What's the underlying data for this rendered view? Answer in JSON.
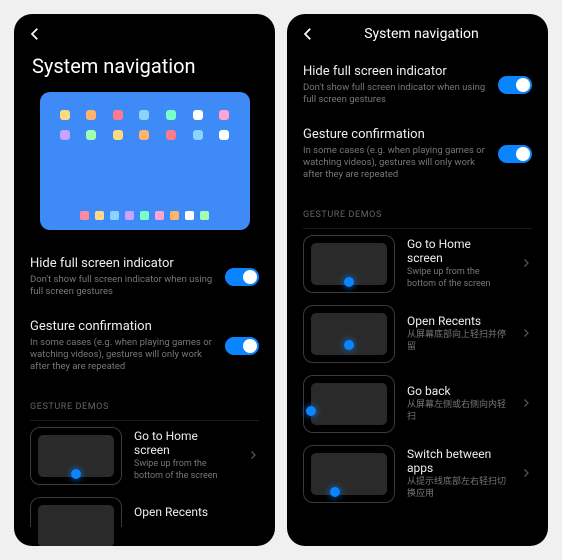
{
  "left": {
    "title": "System navigation",
    "settings": [
      {
        "title": "Hide full screen indicator",
        "desc": "Don't show full screen indicator when using full screen gestures"
      },
      {
        "title": "Gesture confirmation",
        "desc": "In some cases (e.g. when playing games or watching videos), gestures will only work after they are repeated"
      }
    ],
    "section_label": "GESTURE DEMOS",
    "demos": [
      {
        "title": "Go to Home screen",
        "desc": "Swipe up from the bottom of the screen"
      },
      {
        "title": "Open Recents",
        "desc": ""
      }
    ]
  },
  "right": {
    "title": "System navigation",
    "settings": [
      {
        "title": "Hide full screen indicator",
        "desc": "Don't show full screen indicator when using full screen gestures"
      },
      {
        "title": "Gesture confirmation",
        "desc": "In some cases (e.g. when playing games or watching videos), gestures will only work after they are repeated"
      }
    ],
    "section_label": "GESTURE DEMOS",
    "demos": [
      {
        "title": "Go to Home screen",
        "desc": "Swipe up from the bottom of the screen"
      },
      {
        "title": "Open Recents",
        "desc": "从屏幕底部向上轻扫并停留"
      },
      {
        "title": "Go back",
        "desc": "从屏幕左侧或右侧向内轻扫"
      },
      {
        "title": "Switch between apps",
        "desc": "从提示线底部左右轻扫切换应用"
      }
    ]
  },
  "icon_colors": [
    "#ffd980",
    "#ffb36b",
    "#ff7a8a",
    "#8ad4ff",
    "#7affc7",
    "#fff",
    "#ffa3d1",
    "#c8a3ff",
    "#a3ffb0",
    "#ffd980",
    "#ffb36b",
    "#ff7a8a",
    "#8ad4ff",
    "#fff"
  ],
  "dock_colors": [
    "#ff8aa0",
    "#ffd98a",
    "#8ad4ff",
    "#c8a3ff",
    "#7affc7",
    "#ffa3d1",
    "#ffb36b",
    "#fff",
    "#a3ffb0"
  ]
}
